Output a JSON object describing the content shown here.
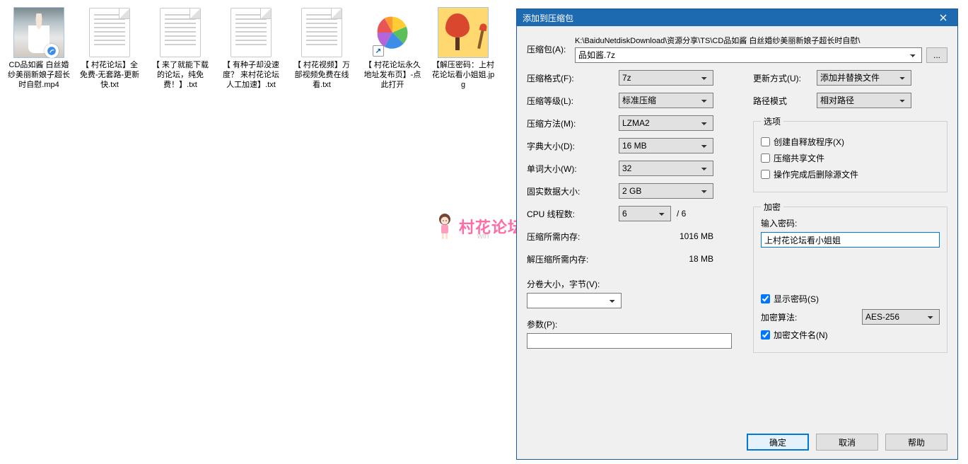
{
  "files": [
    {
      "name": "CD品如酱 白丝婚纱美丽新娘子超长时自慰.mp4",
      "icon": "photo-thumb"
    },
    {
      "name": "【 村花论坛】全免费-无套路-更新快.txt",
      "icon": "text-doc"
    },
    {
      "name": "【 来了就能下载的论坛，纯免费！】.txt",
      "icon": "text-doc"
    },
    {
      "name": "【 有种子却没速度？ 来村花论坛人工加速】.txt",
      "icon": "text-doc"
    },
    {
      "name": "【 村花视频】万部视频免费在线看.txt",
      "icon": "text-doc"
    },
    {
      "name": "【 村花论坛永久地址发布页】-点此打开",
      "icon": "pinwheel"
    },
    {
      "name": "【解压密码：上村花论坛看小姐姐.jpg",
      "icon": "paint-thumb"
    }
  ],
  "watermark": {
    "text": "村花论坛",
    "sub": "win"
  },
  "dialog": {
    "title": "添加到压缩包",
    "archive_label": "压缩包(A):",
    "archive_path": "K:\\BaiduNetdiskDownload\\资源分享\\TS\\CD品如酱 白丝婚纱美丽新娘子超长时自慰\\",
    "archive_name": "品如酱.7z",
    "browse": "...",
    "format_label": "压缩格式(F):",
    "format_value": "7z",
    "level_label": "压缩等级(L):",
    "level_value": "标准压缩",
    "method_label": "压缩方法(M):",
    "method_value": "LZMA2",
    "dict_label": "字典大小(D):",
    "dict_value": "16 MB",
    "word_label": "单词大小(W):",
    "word_value": "32",
    "solid_label": "固实数据大小:",
    "solid_value": "2 GB",
    "cpu_label": "CPU 线程数:",
    "cpu_value": "6",
    "cpu_max": "/ 6",
    "compress_mem_label": "压缩所需内存:",
    "compress_mem_value": "1016 MB",
    "decompress_mem_label": "解压缩所需内存:",
    "decompress_mem_value": "18 MB",
    "split_label": "分卷大小，字节(V):",
    "params_label": "参数(P):",
    "update_label": "更新方式(U):",
    "update_value": "添加并替换文件",
    "pathmode_label": "路径模式",
    "pathmode_value": "相对路径",
    "options_legend": "选项",
    "opt_sfx": "创建自释放程序(X)",
    "opt_shared": "压缩共享文件",
    "opt_delete": "操作完成后删除源文件",
    "encrypt_legend": "加密",
    "password_label": "输入密码:",
    "password_value": "上村花论坛看小姐姐",
    "show_password": "显示密码(S)",
    "enc_method_label": "加密算法:",
    "enc_method_value": "AES-256",
    "encrypt_names": "加密文件名(N)",
    "ok": "确定",
    "cancel": "取消",
    "help": "帮助"
  }
}
